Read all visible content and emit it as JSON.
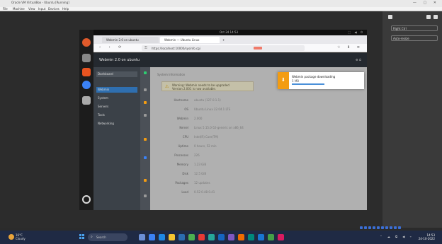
{
  "host": {
    "title": "Oracle VM VirtualBox - Ubuntu [Running]",
    "window_controls": "— ▢ ✕",
    "menu": [
      "File",
      "Machine",
      "View",
      "Input",
      "Devices",
      "Help"
    ]
  },
  "right_panel": {
    "items": [
      "Right Ctrl",
      "Auto-resize"
    ]
  },
  "ubuntu": {
    "clock": "Oct 24 14:53",
    "tray": "⬚ ◀ ⏻"
  },
  "firefox": {
    "tabs": [
      "Webmin 2.0 on ubuntu",
      "Webmin — Ubuntu Linux"
    ],
    "url": "https://localhost:10000/sysinfo.cgi",
    "nav_icons": "‹ › ⟳",
    "right_icons": "☆ ⬇ ≡"
  },
  "webmin": {
    "header_title": "Webmin 2.0 on ubuntu",
    "header_ctrls": "⚙ ⏻",
    "sidebar": [
      "Dashboard",
      "Webmin",
      "System",
      "Servers",
      "Tools",
      "Networking"
    ],
    "main_top": "System Information",
    "warning_line1": "Warning: Webmin needs to be upgraded",
    "warning_line2": "Version 2.001 is now available.",
    "rows": [
      {
        "key": "Hostname",
        "value": "ubuntu (127.0.1.1)"
      },
      {
        "key": "OS",
        "value": "Ubuntu Linux 22.04.1 LTS"
      },
      {
        "key": "Webmin",
        "value": "2.000"
      },
      {
        "key": "Kernel",
        "value": "Linux 5.15.0-52-generic on x86_64"
      },
      {
        "key": "CPU",
        "value": "Intel(R) Core(TM)"
      },
      {
        "key": "Uptime",
        "value": "0 hours, 52 min"
      },
      {
        "key": "Processes",
        "value": "226"
      },
      {
        "key": "Memory",
        "value": "1.23 GiB"
      },
      {
        "key": "Disk",
        "value": "12.5 GiB"
      },
      {
        "key": "Packages",
        "value": "12 updates"
      },
      {
        "key": "Load",
        "value": "0.52 0.48 0.41"
      }
    ]
  },
  "notification": {
    "title": "Webmin package downloading",
    "sub": "5 MB"
  },
  "taskbar": {
    "weather_temp": "16°C",
    "weather_desc": "Cloudy",
    "search_label": "Search",
    "tray": "⌃ ☁ ⧉ ◀ ⌁",
    "time": "14:53",
    "date": "24-10-2022"
  }
}
